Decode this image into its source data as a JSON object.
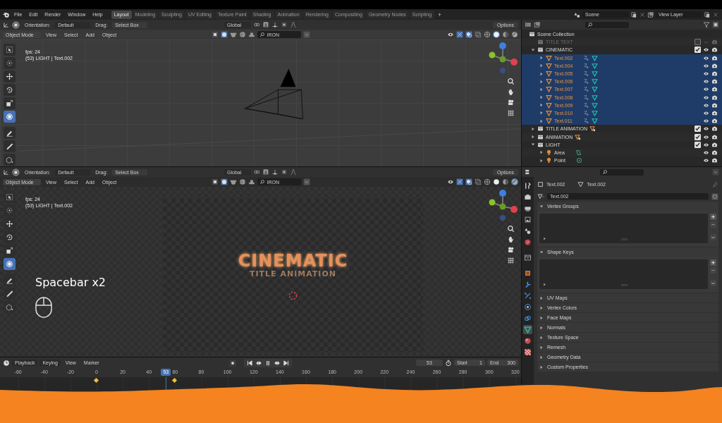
{
  "topbar": {
    "menus": [
      "File",
      "Edit",
      "Render",
      "Window",
      "Help"
    ],
    "workspaces": [
      {
        "label": "Layout",
        "selected": true
      },
      {
        "label": "Modeling",
        "selected": false
      },
      {
        "label": "Sculpting",
        "selected": false
      },
      {
        "label": "UV Editing",
        "selected": false
      },
      {
        "label": "Texture Paint",
        "selected": false
      },
      {
        "label": "Shading",
        "selected": false
      },
      {
        "label": "Animation",
        "selected": false
      },
      {
        "label": "Rendering",
        "selected": false
      },
      {
        "label": "Compositing",
        "selected": false
      },
      {
        "label": "Geometry Nodes",
        "selected": false
      },
      {
        "label": "Scripting",
        "selected": false
      }
    ],
    "add_workspace": "+",
    "scene": "Scene",
    "view_layer": "View Layer"
  },
  "viewports": [
    {
      "kind": "wireframe",
      "orientation_label": "Orientation:",
      "orientation": "Default",
      "drag_label": "Drag:",
      "drag": "Select Box",
      "transform": "Global",
      "options": "Options",
      "mode": "Object Mode",
      "menus": [
        "View",
        "Select",
        "Add",
        "Object"
      ],
      "material": "IRON",
      "fps": "fps: 24",
      "info": "(53) LIGHT | Text.002",
      "shading": [
        {
          "kind": "wireframe",
          "selected": false
        },
        {
          "kind": "solid",
          "selected": true
        },
        {
          "kind": "material",
          "selected": false
        },
        {
          "kind": "rendered",
          "selected": false
        }
      ],
      "tools": [
        {
          "kind": "select-box",
          "selected": false
        },
        {
          "kind": "cursor",
          "selected": false
        },
        {
          "kind": "move",
          "selected": false
        },
        {
          "kind": "rotate",
          "selected": false
        },
        {
          "kind": "scale",
          "selected": false
        },
        {
          "kind": "transform",
          "selected": true
        },
        {
          "kind": "pen",
          "selected": false
        },
        {
          "kind": "ruler",
          "selected": false
        },
        {
          "kind": "cube",
          "selected": false
        }
      ]
    },
    {
      "kind": "render",
      "orientation_label": "Orientation:",
      "orientation": "Default",
      "drag_label": "Drag:",
      "drag": "Select Box",
      "transform": "Global",
      "options": "Options",
      "mode": "Object Mode",
      "menus": [
        "View",
        "Select",
        "Add",
        "Object"
      ],
      "material": "IRON",
      "fps": "fps: 24",
      "info": "(53) LIGHT | Text.002",
      "title_text": "CINEMATIC",
      "subtitle_text": "TITLE ANIMATION",
      "hint": "Spacebar x2",
      "shading": [
        {
          "kind": "wireframe",
          "selected": false
        },
        {
          "kind": "solid",
          "selected": false
        },
        {
          "kind": "material",
          "selected": false
        },
        {
          "kind": "rendered",
          "selected": true
        }
      ],
      "tools": [
        {
          "kind": "select-box",
          "selected": false
        },
        {
          "kind": "cursor",
          "selected": false
        },
        {
          "kind": "move",
          "selected": false
        },
        {
          "kind": "rotate",
          "selected": false
        },
        {
          "kind": "scale",
          "selected": false
        },
        {
          "kind": "transform",
          "selected": true
        },
        {
          "kind": "pen",
          "selected": false
        },
        {
          "kind": "ruler",
          "selected": false
        },
        {
          "kind": "cube",
          "selected": false
        }
      ]
    }
  ],
  "timeline": {
    "menus": [
      "Playback",
      "Keying",
      "View",
      "Marker"
    ],
    "frame": "53",
    "start_label": "Start",
    "start": "1",
    "end_label": "End",
    "end": "300",
    "ticks": [
      "-60",
      "-40",
      "-20",
      "0",
      "20",
      "40",
      "60",
      "80",
      "100",
      "120",
      "140",
      "160",
      "180",
      "200",
      "220",
      "240",
      "260",
      "280",
      "300",
      "320"
    ],
    "playhead": "53"
  },
  "outliner": {
    "root": "Scene Collection",
    "items": [
      {
        "label": "TITLE TEXT",
        "kind": "collection",
        "checked": false,
        "disabled": true
      },
      {
        "label": "CINEMATIC",
        "kind": "collection",
        "expanded": true,
        "checked": true,
        "disabled": false,
        "children": [
          {
            "label": "Text.002",
            "kind": "text",
            "selected": true
          },
          {
            "label": "Text.004",
            "kind": "text",
            "selected": true
          },
          {
            "label": "Text.005",
            "kind": "text",
            "selected": true
          },
          {
            "label": "Text.006",
            "kind": "text",
            "selected": true
          },
          {
            "label": "Text.007",
            "kind": "text",
            "selected": true
          },
          {
            "label": "Text.008",
            "kind": "text",
            "selected": true
          },
          {
            "label": "Text.009",
            "kind": "text",
            "selected": true
          },
          {
            "label": "Text.010",
            "kind": "text",
            "selected": true
          },
          {
            "label": "Text.011",
            "kind": "text",
            "selected": true
          }
        ]
      },
      {
        "label": "TITLE ANIMATION",
        "kind": "collection",
        "expanded": false,
        "checked": true,
        "disabled": false
      },
      {
        "label": "ANIMATION",
        "kind": "collection",
        "expanded": false,
        "checked": true,
        "disabled": false
      },
      {
        "label": "LIGHT",
        "kind": "collection",
        "expanded": true,
        "checked": true,
        "disabled": false,
        "children": [
          {
            "label": "Area",
            "kind": "area-light",
            "selected": false
          },
          {
            "label": "Point",
            "kind": "point-light",
            "selected": false
          }
        ]
      }
    ]
  },
  "properties": {
    "object": "Text.002",
    "data": "Text.002",
    "data_name": "Text.002",
    "tabs": [
      {
        "kind": "screwdriver",
        "selected": false
      },
      {
        "kind": "camera-back",
        "selected": false
      },
      {
        "kind": "printer",
        "selected": false
      },
      {
        "kind": "image-stack",
        "selected": false
      },
      {
        "kind": "cone-sphere",
        "selected": false
      },
      {
        "kind": "globe",
        "selected": false
      },
      {
        "kind": "box",
        "selected": false
      },
      {
        "kind": "square",
        "selected": false
      },
      {
        "kind": "wrench",
        "selected": false
      },
      {
        "kind": "particles",
        "selected": false
      },
      {
        "kind": "orbit",
        "selected": false
      },
      {
        "kind": "link",
        "selected": false
      },
      {
        "kind": "triangle",
        "selected": true
      },
      {
        "kind": "sphere",
        "selected": false
      },
      {
        "kind": "checker",
        "selected": false
      }
    ],
    "panels": [
      {
        "label": "Vertex Groups",
        "expanded": true
      },
      {
        "label": "Shape Keys",
        "expanded": true
      },
      {
        "label": "UV Maps",
        "expanded": false
      },
      {
        "label": "Vertex Colors",
        "expanded": false
      },
      {
        "label": "Face Maps",
        "expanded": false
      },
      {
        "label": "Normals",
        "expanded": false
      },
      {
        "label": "Texture Space",
        "expanded": false
      },
      {
        "label": "Remesh",
        "expanded": false
      },
      {
        "label": "Geometry Data",
        "expanded": false
      },
      {
        "label": "Custom Properties",
        "expanded": false
      }
    ]
  }
}
